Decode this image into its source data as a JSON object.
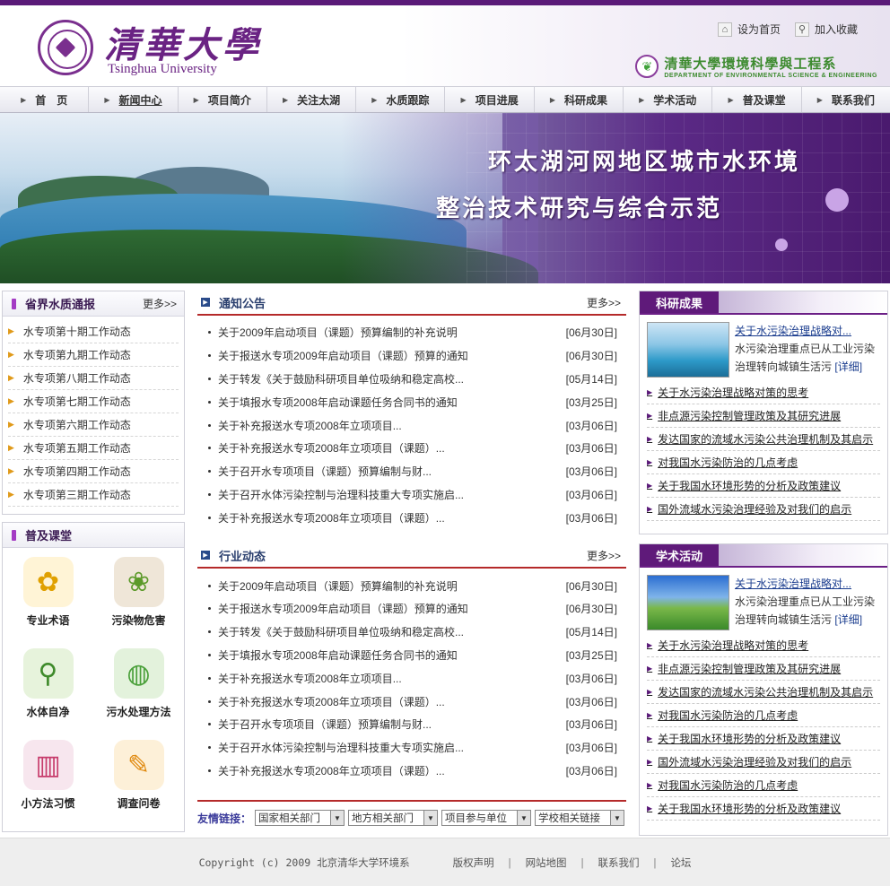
{
  "header": {
    "logo_cn": "清華大學",
    "logo_en": "Tsinghua University",
    "links": {
      "home": "设为首页",
      "favorite": "加入收藏"
    },
    "dept_cn": "清華大學環境科學與工程系",
    "dept_en": "DEPARTMENT OF ENVIRONMENTAL SCIENCE & ENGINEERING"
  },
  "nav": {
    "items": [
      "首　页",
      "新闻中心",
      "项目简介",
      "关注太湖",
      "水质跟踪",
      "项目进展",
      "科研成果",
      "学术活动",
      "普及课堂",
      "联系我们"
    ]
  },
  "banner": {
    "line1": "环太湖河网地区城市水环境",
    "line2": "整治技术研究与综合示范"
  },
  "left": {
    "water": {
      "title": "省界水质通报",
      "more": "更多>>",
      "items": [
        "水专项第十期工作动态",
        "水专项第九期工作动态",
        "水专项第八期工作动态",
        "水专项第七期工作动态",
        "水专项第六期工作动态",
        "水专项第五期工作动态",
        "水专项第四期工作动态",
        "水专项第三期工作动态"
      ]
    },
    "edu": {
      "title": "普及课堂",
      "items": [
        "专业术语",
        "污染物危害",
        "水体自净",
        "污水处理方法",
        "小方法习惯",
        "调查问卷"
      ]
    }
  },
  "notice": {
    "title": "通知公告",
    "more": "更多>>",
    "items": [
      {
        "text": "关于2009年启动项目（课题）预算编制的补充说明",
        "date": "[06月30日]"
      },
      {
        "text": "关于报送水专项2009年启动项目（课题）预算的通知",
        "date": "[06月30日]"
      },
      {
        "text": "关于转发《关于鼓励科研项目单位吸纳和稳定高校...",
        "date": "[05月14日]"
      },
      {
        "text": "关于填报水专项2008年启动课题任务合同书的通知",
        "date": "[03月25日]"
      },
      {
        "text": "关于补充报送水专项2008年立项项目...",
        "date": "[03月06日]"
      },
      {
        "text": "关于补充报送水专项2008年立项项目（课题）...",
        "date": "[03月06日]"
      },
      {
        "text": "关于召开水专项项目（课题）预算编制与财...",
        "date": "[03月06日]"
      },
      {
        "text": "关于召开水体污染控制与治理科技重大专项实施启...",
        "date": "[03月06日]"
      },
      {
        "text": "关于补充报送水专项2008年立项项目（课题）...",
        "date": "[03月06日]"
      }
    ]
  },
  "industry": {
    "title": "行业动态",
    "more": "更多>>",
    "items": [
      {
        "text": "关于2009年启动项目（课题）预算编制的补充说明",
        "date": "[06月30日]"
      },
      {
        "text": "关于报送水专项2009年启动项目（课题）预算的通知",
        "date": "[06月30日]"
      },
      {
        "text": "关于转发《关于鼓励科研项目单位吸纳和稳定高校...",
        "date": "[05月14日]"
      },
      {
        "text": "关于填报水专项2008年启动课题任务合同书的通知",
        "date": "[03月25日]"
      },
      {
        "text": "关于补充报送水专项2008年立项项目...",
        "date": "[03月06日]"
      },
      {
        "text": "关于补充报送水专项2008年立项项目（课题）...",
        "date": "[03月06日]"
      },
      {
        "text": "关于召开水专项项目（课题）预算编制与财...",
        "date": "[03月06日]"
      },
      {
        "text": "关于召开水体污染控制与治理科技重大专项实施启...",
        "date": "[03月06日]"
      },
      {
        "text": "关于补充报送水专项2008年立项项目（课题）...",
        "date": "[03月06日]"
      }
    ]
  },
  "friend": {
    "label": "友情链接：",
    "selects": [
      "国家相关部门",
      "地方相关部门",
      "项目参与单位",
      "学校相关链接"
    ]
  },
  "research": {
    "title": "科研成果",
    "feature_title": "关于水污染治理战略对...",
    "feature_desc1": "水污染治理重点已从工业污染",
    "feature_desc2": "治理转向城镇生活污",
    "feature_more": "[详细]",
    "items": [
      "关于水污染治理战略对策的思考",
      "非点源污染控制管理政策及其研究进展",
      "发达国家的流域水污染公共治理机制及其启示",
      "对我国水污染防治的几点考虑",
      "关于我国水环境形势的分析及政策建议",
      "国外流域水污染治理经验及对我们的启示"
    ]
  },
  "academic": {
    "title": "学术活动",
    "feature_title": "关于水污染治理战略对...",
    "feature_desc1": "水污染治理重点已从工业污染",
    "feature_desc2": "治理转向城镇生活污",
    "feature_more": "[详细]",
    "items": [
      "关于水污染治理战略对策的思考",
      "非点源污染控制管理政策及其研究进展",
      "发达国家的流域水污染公共治理机制及其启示",
      "对我国水污染防治的几点考虑",
      "关于我国水环境形势的分析及政策建议",
      "国外流域水污染治理经验及对我们的启示",
      "对我国水污染防治的几点考虑",
      "关于我国水环境形势的分析及政策建议"
    ]
  },
  "footer": {
    "copyright": "Copyright (c) 2009 北京清华大学环境系",
    "links": [
      "版权声明",
      "网站地图",
      "联系我们",
      "论坛"
    ]
  }
}
